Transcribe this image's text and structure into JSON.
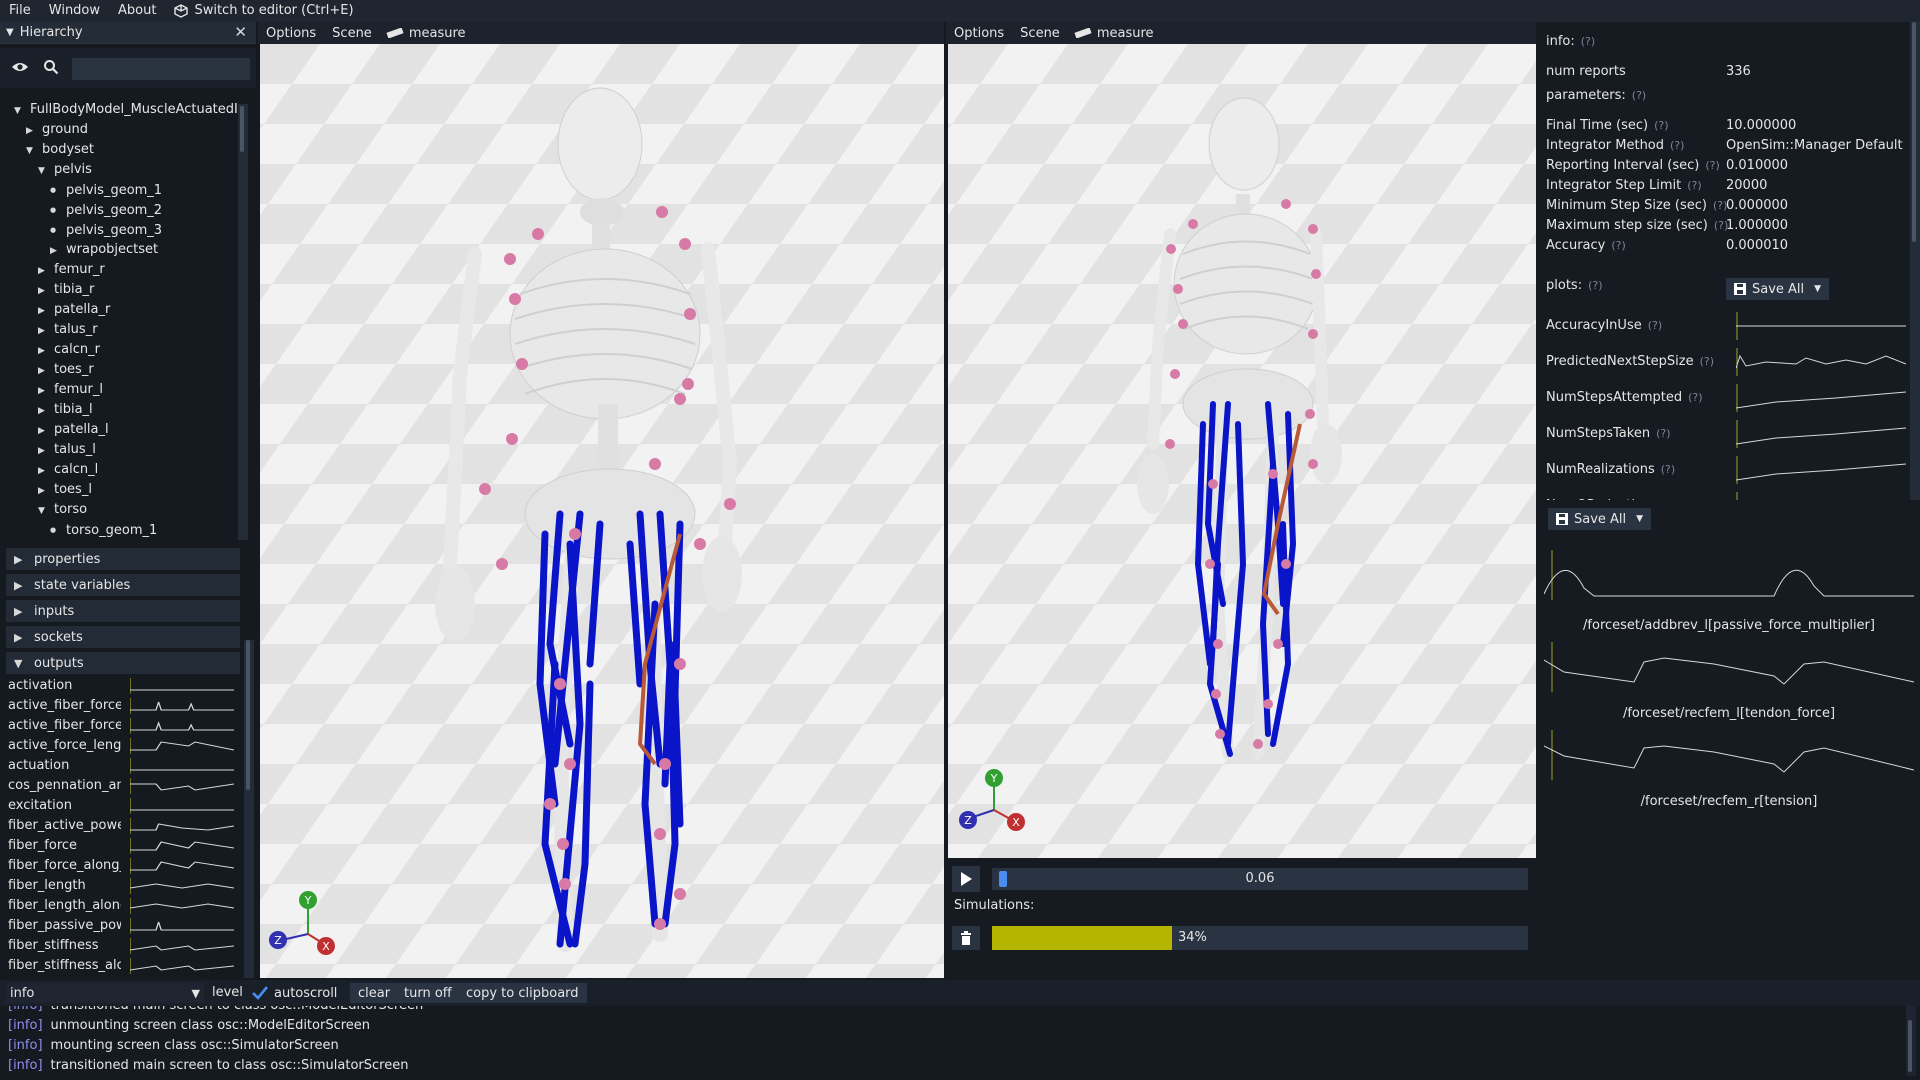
{
  "menu": {
    "file": "File",
    "window": "Window",
    "about": "About",
    "switch_editor": "Switch to editor (Ctrl+E)"
  },
  "hierarchy": {
    "title": "Hierarchy",
    "search_placeholder": "",
    "tree": [
      {
        "label": "FullBodyModel_MuscleActuatedI",
        "depth": 0,
        "kind": "open"
      },
      {
        "label": "ground",
        "depth": 1,
        "kind": "closed"
      },
      {
        "label": "bodyset",
        "depth": 1,
        "kind": "open"
      },
      {
        "label": "pelvis",
        "depth": 2,
        "kind": "open"
      },
      {
        "label": "pelvis_geom_1",
        "depth": 3,
        "kind": "leaf"
      },
      {
        "label": "pelvis_geom_2",
        "depth": 3,
        "kind": "leaf"
      },
      {
        "label": "pelvis_geom_3",
        "depth": 3,
        "kind": "leaf"
      },
      {
        "label": "wrapobjectset",
        "depth": 3,
        "kind": "closed"
      },
      {
        "label": "femur_r",
        "depth": 2,
        "kind": "closed"
      },
      {
        "label": "tibia_r",
        "depth": 2,
        "kind": "closed"
      },
      {
        "label": "patella_r",
        "depth": 2,
        "kind": "closed"
      },
      {
        "label": "talus_r",
        "depth": 2,
        "kind": "closed"
      },
      {
        "label": "calcn_r",
        "depth": 2,
        "kind": "closed"
      },
      {
        "label": "toes_r",
        "depth": 2,
        "kind": "closed"
      },
      {
        "label": "femur_l",
        "depth": 2,
        "kind": "closed"
      },
      {
        "label": "tibia_l",
        "depth": 2,
        "kind": "closed"
      },
      {
        "label": "patella_l",
        "depth": 2,
        "kind": "closed"
      },
      {
        "label": "talus_l",
        "depth": 2,
        "kind": "closed"
      },
      {
        "label": "calcn_l",
        "depth": 2,
        "kind": "closed"
      },
      {
        "label": "toes_l",
        "depth": 2,
        "kind": "closed"
      },
      {
        "label": "torso",
        "depth": 2,
        "kind": "open"
      },
      {
        "label": "torso_geom_1",
        "depth": 3,
        "kind": "leaf"
      }
    ]
  },
  "sections": {
    "properties": "properties",
    "state_variables": "state variables",
    "inputs": "inputs",
    "sockets": "sockets",
    "outputs": "outputs"
  },
  "outputs": [
    "activation",
    "active_fiber_force",
    "active_fiber_force_along_tendon",
    "active_force_length_multiplier",
    "actuation",
    "cos_pennation_angle",
    "excitation",
    "fiber_active_power",
    "fiber_force",
    "fiber_force_along_tendon",
    "fiber_length",
    "fiber_length_along_tendon",
    "fiber_passive_power",
    "fiber_stiffness",
    "fiber_stiffness_along_tendon"
  ],
  "viewport_left": {
    "options": "Options",
    "scene": "Scene",
    "measure": "measure",
    "axis_y": "Y",
    "axis_z": "Z",
    "axis_x": "X"
  },
  "viewport_right": {
    "options": "Options",
    "scene": "Scene",
    "measure": "measure",
    "axis_y": "Y",
    "axis_z": "Z",
    "axis_x": "X"
  },
  "playback": {
    "time": "0.06",
    "progress": 0.006
  },
  "simulations": {
    "label": "Simulations:",
    "progress_text": "34%",
    "progress": 0.34,
    "bar_color": "#b5b500"
  },
  "info_panel": {
    "info_label": "info:",
    "help": "(?)",
    "num_reports_label": "num reports",
    "num_reports_value": "336",
    "parameters_label": "parameters:",
    "params": [
      {
        "label": "Final Time (sec)",
        "value": "10.000000"
      },
      {
        "label": "Integrator Method",
        "value": "OpenSim::Manager Default"
      },
      {
        "label": "Reporting Interval (sec)",
        "value": "0.010000"
      },
      {
        "label": "Integrator Step Limit",
        "value": "20000"
      },
      {
        "label": "Minimum Step Size (sec)",
        "value": "0.000000"
      },
      {
        "label": "Maximum step size (sec)",
        "value": "1.000000"
      },
      {
        "label": "Accuracy",
        "value": "0.000010"
      }
    ],
    "plots_label": "plots:",
    "save_all": "Save All",
    "plots": [
      "AccuracyInUse",
      "PredictedNextStepSize",
      "NumStepsAttempted",
      "NumStepsTaken",
      "NumRealizations",
      "NumQProjections"
    ]
  },
  "output_plots": {
    "save_all": "Save All",
    "labels": [
      "/forceset/addbrev_l[passive_force_multiplier]",
      "/forceset/recfem_l[tendon_force]",
      "/forceset/recfem_r[tension]"
    ]
  },
  "log_toolbar": {
    "level_value": "info",
    "level_label": "level",
    "autoscroll": "autoscroll",
    "clear": "clear",
    "turn_off": "turn off",
    "copy": "copy to clipboard"
  },
  "log": [
    {
      "level": "[info]",
      "msg": "transitioned main screen to class osc::ModelEditorScreen"
    },
    {
      "level": "[info]",
      "msg": "unmounting screen class osc::ModelEditorScreen"
    },
    {
      "level": "[info]",
      "msg": "mounting screen class osc::SimulatorScreen"
    },
    {
      "level": "[info]",
      "msg": "transitioned main screen to class osc::SimulatorScreen"
    }
  ],
  "colors": {
    "muscle": "#0a14c8",
    "marker": "#d77aa6",
    "bone": "#e8e8e8",
    "axis_x": "#c03030",
    "axis_y": "#30a030",
    "axis_z": "#3030b0"
  }
}
